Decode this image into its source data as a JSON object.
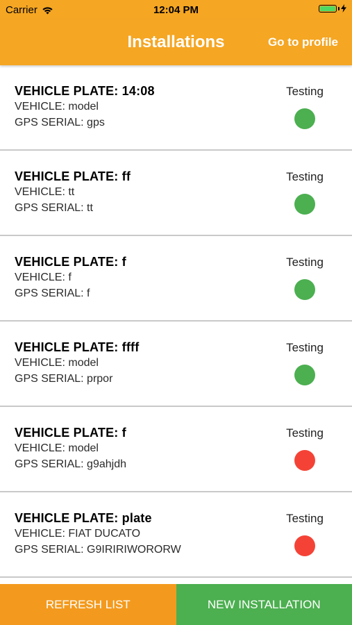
{
  "status_bar": {
    "carrier": "Carrier",
    "time": "12:04 PM"
  },
  "header": {
    "title": "Installations",
    "profile_link": "Go to profile"
  },
  "installations": [
    {
      "plate": "VEHICLE PLATE: 14:08",
      "vehicle": "VEHICLE: model",
      "gps": "GPS SERIAL: gps",
      "status": "Testing",
      "status_color": "#4CAF50"
    },
    {
      "plate": "VEHICLE PLATE: ff",
      "vehicle": "VEHICLE: tt",
      "gps": "GPS SERIAL: tt",
      "status": "Testing",
      "status_color": "#4CAF50"
    },
    {
      "plate": "VEHICLE PLATE: f",
      "vehicle": "VEHICLE: f",
      "gps": "GPS SERIAL: f",
      "status": "Testing",
      "status_color": "#4CAF50"
    },
    {
      "plate": "VEHICLE PLATE: ffff",
      "vehicle": "VEHICLE: model",
      "gps": "GPS SERIAL: prpor",
      "status": "Testing",
      "status_color": "#4CAF50"
    },
    {
      "plate": "VEHICLE PLATE: f",
      "vehicle": "VEHICLE: model",
      "gps": "GPS SERIAL: g9ahjdh",
      "status": "Testing",
      "status_color": "#F44336"
    },
    {
      "plate": "VEHICLE PLATE: plate",
      "vehicle": "VEHICLE: FIAT DUCATO",
      "gps": "GPS SERIAL: G9IRIRIWORORW",
      "status": "Testing",
      "status_color": "#F44336"
    }
  ],
  "footer": {
    "refresh_label": "REFRESH LIST",
    "refresh_color": "#F39A1E",
    "new_label": "NEW INSTALLATION",
    "new_color": "#4CAF50"
  },
  "colors": {
    "accent": "#F5A623",
    "status_ok": "#4CAF50",
    "status_error": "#F44336"
  },
  "icons": {
    "signal": "wifi-icon",
    "battery": "battery-icon",
    "charging": "charging-bolt-icon"
  }
}
